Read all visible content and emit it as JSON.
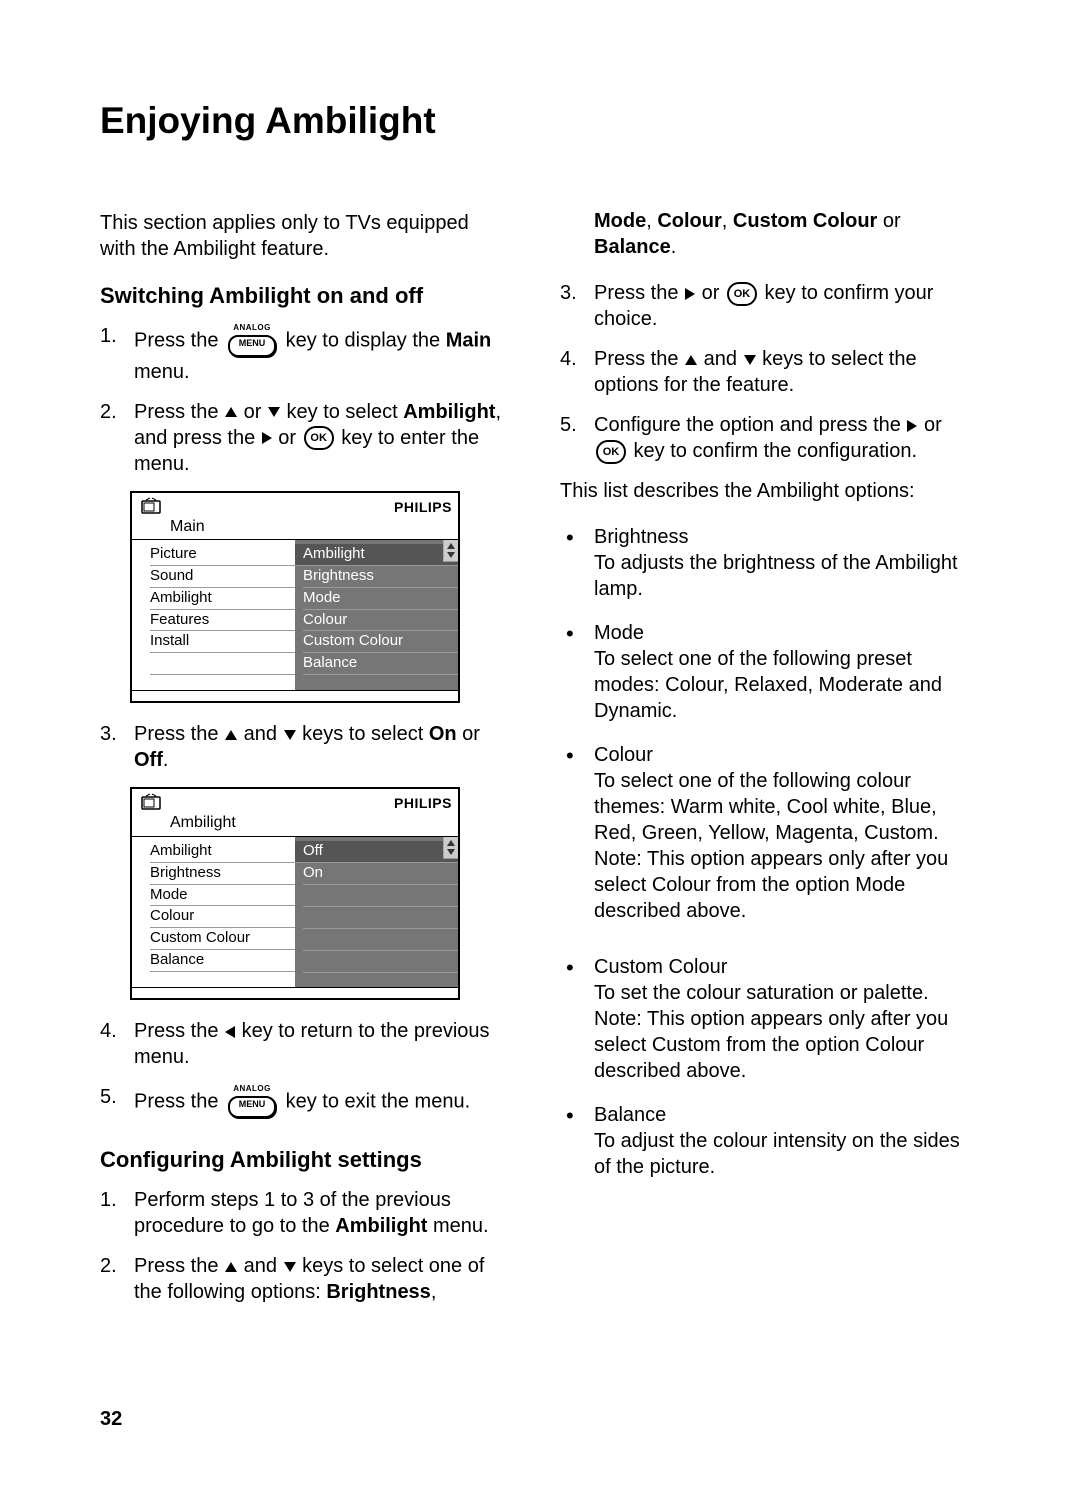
{
  "page_number": "32",
  "title": "Enjoying Ambilight",
  "intro": "This section applies only to TVs equipped with the Ambilight feature.",
  "sections": {
    "switch": {
      "heading": "Switching Ambilight on and off",
      "step1_a": "Press the ",
      "step1_b": " key to display the ",
      "step1_c": "Main",
      "step1_d": " menu.",
      "step2_a": "Press the ",
      "step2_b": " or ",
      "step2_c": " key to select ",
      "step2_d": "Ambilight",
      "step2_e": ",  and press the ",
      "step2_f": " or ",
      "step2_g": " key to enter the menu.",
      "step3_a": "Press the ",
      "step3_b": " and ",
      "step3_c": " keys to select ",
      "step3_d": "On",
      "step3_e": " or ",
      "step3_f": "Off",
      "step3_g": ".",
      "step4_a": "Press the ",
      "step4_b": " key to return to the previous menu.",
      "step5_a": "Press the ",
      "step5_b": " key to exit the menu."
    },
    "configure": {
      "heading": "Configuring Ambilight settings",
      "step1_a": "Perform steps 1 to 3 of the previous procedure to go to the ",
      "step1_b": "Ambilight",
      "step1_c": " menu.",
      "step2_a": "Press the ",
      "step2_b": " and ",
      "step2_c": " keys to select one of the following options: ",
      "step2_d": "Brightness",
      "step2_e": ", ",
      "cont_a": "Mode",
      "cont_b": ", ",
      "cont_c": "Colour",
      "cont_d": ", ",
      "cont_e": "Custom Colour",
      "cont_f": " or ",
      "cont_g": "Balance",
      "cont_h": ".",
      "step3_a": "Press the ",
      "step3_b": " or ",
      "step3_c": " key to confirm your choice.",
      "step4_a": "Press the ",
      "step4_b": " and ",
      "step4_c": " keys to select the options for the feature.",
      "step5_a": "Configure the option and press the ",
      "step5_b": " or ",
      "step5_c": " key to confirm the configuration."
    }
  },
  "list_intro": "This list describes the Ambilight options:",
  "options": {
    "brightness_t": "Brightness",
    "brightness_d": "To adjusts the brightness of the Ambilight lamp.",
    "mode_t": "Mode",
    "mode_d": "To select one of the following preset modes: Colour, Relaxed, Moderate and Dynamic.",
    "colour_t": "Colour",
    "colour_d1": "To select one of the following colour themes: Warm white, Cool white, Blue, Red, Green, Yellow, Magenta, Custom. Note: This option appears only after you select ",
    "colour_d2": "Colour",
    "colour_d3": " from the option ",
    "colour_d4": "Mode",
    "colour_d5": " described above.",
    "custom_t": "Custom Colour",
    "custom_d1": "To set the colour saturation or palette. Note: This option appears only after you select ",
    "custom_d2": "Custom",
    "custom_d3": " from the option ",
    "custom_d4": "Colour",
    "custom_d5": " described above.",
    "balance_t": "Balance",
    "balance_d": "To adjust the colour intensity on the sides of the picture."
  },
  "osd": {
    "brand": "PHILIPS",
    "menu_analog": "ANALOG",
    "ok": "OK",
    "m1": {
      "title": "Main",
      "left": [
        "Picture",
        "Sound",
        "Ambilight",
        "Features",
        "Install"
      ],
      "right": [
        "Ambilight",
        "Brightness",
        "Mode",
        "Colour",
        "Custom Colour",
        "Balance"
      ]
    },
    "m2": {
      "title": "Ambilight",
      "left": [
        "Ambilight",
        "Brightness",
        "Mode",
        "Colour",
        "Custom Colour",
        "Balance"
      ],
      "right": [
        "Off",
        "On"
      ]
    }
  }
}
